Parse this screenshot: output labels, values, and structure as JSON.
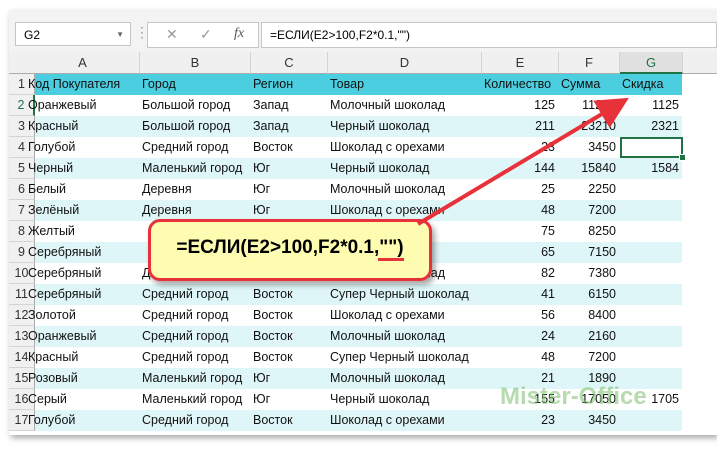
{
  "name_box": "G2",
  "formula_bar": "=ЕСЛИ(E2>100,F2*0.1,\"\")",
  "fx_buttons": {
    "cancel": "✕",
    "enter": "✓",
    "fx": "fx"
  },
  "columns": [
    "A",
    "B",
    "C",
    "D",
    "E",
    "F",
    "G"
  ],
  "selected_column": "G",
  "headers": [
    "Код Покупателя",
    "Город",
    "Регион",
    "Товар",
    "Количество",
    "Сумма",
    "Скидка"
  ],
  "rows": [
    [
      "Оранжевый",
      "Большой город",
      "Запад",
      "Молочный шоколад",
      "125",
      "11250",
      "1125"
    ],
    [
      "Красный",
      "Большой город",
      "Запад",
      "Черный шоколад",
      "211",
      "23210",
      "2321"
    ],
    [
      "Голубой",
      "Средний город",
      "Восток",
      "Шоколад с орехами",
      "23",
      "3450",
      ""
    ],
    [
      "Черный",
      "Маленький город",
      "Юг",
      "Черный шоколад",
      "144",
      "15840",
      "1584"
    ],
    [
      "Белый",
      "Деревня",
      "Юг",
      "Молочный шоколад",
      "25",
      "2250",
      ""
    ],
    [
      "Зелёный",
      "Деревня",
      "Юг",
      "Шоколад с орехами",
      "48",
      "7200",
      ""
    ],
    [
      "Желтый",
      "",
      "",
      "",
      "75",
      "8250",
      ""
    ],
    [
      "Серебряный",
      "",
      "",
      "",
      "65",
      "7150",
      ""
    ],
    [
      "Серебряный",
      "Деревня",
      "Юг",
      "Молочный шоколад",
      "82",
      "7380",
      ""
    ],
    [
      "Серебряный",
      "Средний город",
      "Восток",
      "Супер Черный шоколад",
      "41",
      "6150",
      ""
    ],
    [
      "Золотой",
      "Средний город",
      "Восток",
      "Шоколад с орехами",
      "56",
      "8400",
      ""
    ],
    [
      "Оранжевый",
      "Средний город",
      "Восток",
      "Молочный шоколад",
      "24",
      "2160",
      ""
    ],
    [
      "Красный",
      "Средний город",
      "Восток",
      "Супер Черный шоколад",
      "48",
      "7200",
      ""
    ],
    [
      "Розовый",
      "Маленький город",
      "Юг",
      "Молочный шоколад",
      "21",
      "1890",
      ""
    ],
    [
      "Серый",
      "Маленький город",
      "Юг",
      "Черный шоколад",
      "155",
      "17050",
      "1705"
    ],
    [
      "Голубой",
      "Средний город",
      "Восток",
      "Шоколад с орехами",
      "23",
      "3450",
      ""
    ]
  ],
  "callout": "=ЕСЛИ(E2>100,F2*0.1,\"\")",
  "watermark": "Mister-Office",
  "colors": {
    "header_fill": "#4bcee0",
    "band_fill": "#dff6f8",
    "accent": "#217346",
    "callout_border": "#e8323a",
    "callout_fill": "#fdfcb0"
  }
}
